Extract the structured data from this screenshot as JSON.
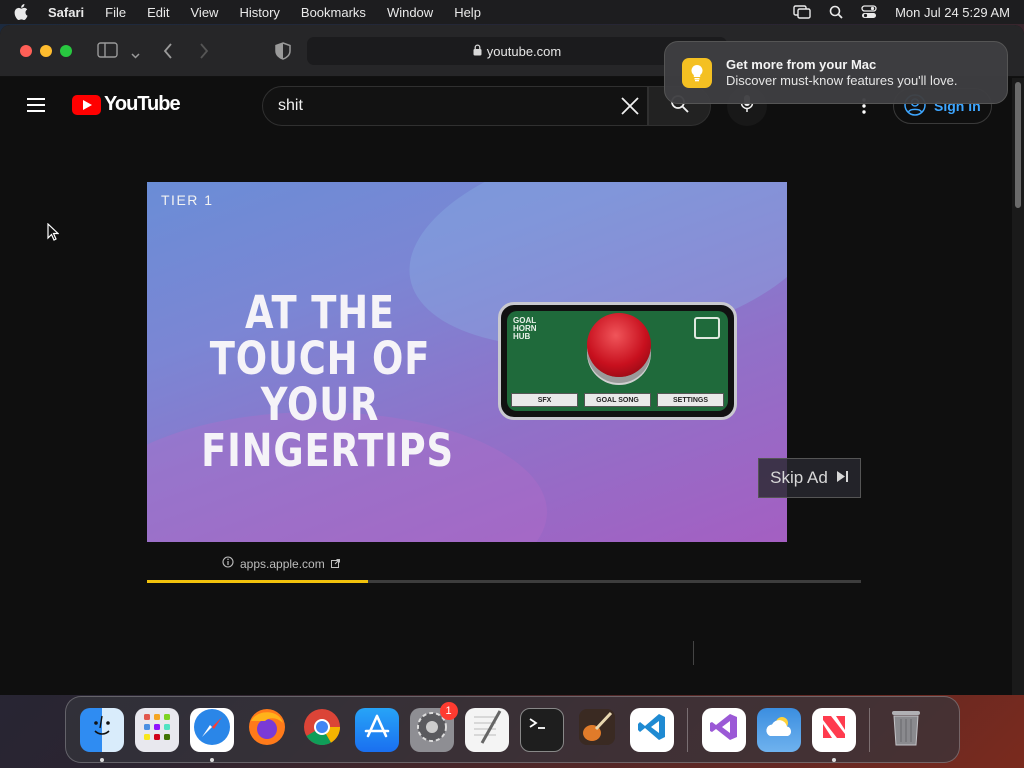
{
  "menubar": {
    "app_name": "Safari",
    "menus": [
      "File",
      "Edit",
      "View",
      "History",
      "Bookmarks",
      "Window",
      "Help"
    ],
    "clock": "Mon Jul 24  5:29 AM"
  },
  "browser": {
    "url": "youtube.com"
  },
  "youtube": {
    "logo_text": "YouTube",
    "search_value": "shit",
    "signin_label": "Sign in"
  },
  "ad": {
    "tier_label": "TIER 1",
    "headline": "AT THE TOUCH OF YOUR FINGERTIPS",
    "app_logo": "GOAL HORN HUB",
    "phone_tabs": [
      "SFX",
      "GOAL SONG",
      "SETTINGS"
    ],
    "skip_label": "Skip Ad",
    "advertiser_url": "apps.apple.com",
    "progress_fraction": 0.31
  },
  "notification": {
    "title": "Get more from your Mac",
    "body": "Discover must-know features you'll love."
  },
  "dock": {
    "apps": [
      {
        "name": "finder",
        "color": "#2f8cf2",
        "running": true
      },
      {
        "name": "launchpad",
        "color": "#e8e8ee",
        "running": false
      },
      {
        "name": "safari",
        "color": "#2a86e8",
        "running": true
      },
      {
        "name": "firefox",
        "color": "#ff7a1a",
        "running": false
      },
      {
        "name": "chrome",
        "color": "#ffffff",
        "running": false
      },
      {
        "name": "app-store",
        "color": "#1d8cf5",
        "running": false
      },
      {
        "name": "system-settings",
        "color": "#8e8e93",
        "running": false,
        "badge": "1"
      },
      {
        "name": "textedit",
        "color": "#f4f4f4",
        "running": false
      },
      {
        "name": "terminal",
        "color": "#1e1e1e",
        "running": false
      },
      {
        "name": "garageband",
        "color": "#6a3a2a",
        "running": false
      },
      {
        "name": "vscode",
        "color": "#ffffff",
        "running": false
      },
      {
        "name": "visual-studio",
        "color": "#ffffff",
        "running": false
      },
      {
        "name": "weather",
        "color": "#3b8ee0",
        "running": false
      },
      {
        "name": "news",
        "color": "#ffffff",
        "running": true
      },
      {
        "name": "trash",
        "color": "#8a8a8e",
        "running": false
      }
    ]
  }
}
